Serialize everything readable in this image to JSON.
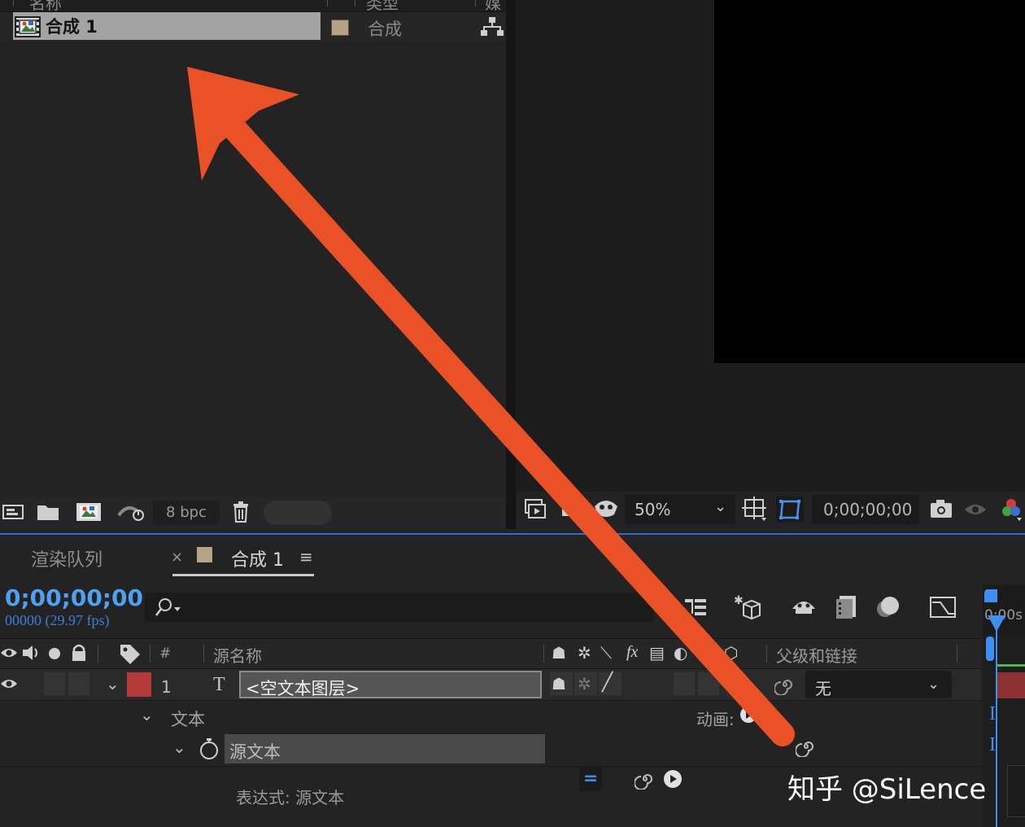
{
  "project": {
    "header_name": "名称",
    "header_type": "类型",
    "header_media": "媒",
    "item": {
      "name": "合成 1",
      "type": "合成",
      "type_color": "#b6a385"
    },
    "footer": {
      "bpc": "8 bpc"
    }
  },
  "viewer": {
    "zoom": "50%",
    "timecode": "0;00;00;00"
  },
  "timeline": {
    "tabs": {
      "render_queue": "渲染队列",
      "comp": "合成 1",
      "close": "×",
      "menu": "≡"
    },
    "timecode": "0;00;00;00",
    "fps": "00000 (29.97 fps)",
    "search": {
      "value": "",
      "placeholder": ""
    },
    "ruler_label": "0:00s",
    "columns": {
      "num": "#",
      "source_name": "源名称",
      "fx": "fx",
      "parent": "父级和链接"
    },
    "layer": {
      "number": "1",
      "type_glyph": "T",
      "name": "<空文本图层>",
      "label_color": "#b43a3a",
      "parent": "无"
    },
    "text_group": "文本",
    "animate_label": "动画:",
    "source_text": "源文本",
    "expression_label": "表达式: 源文本",
    "expr_eq": "="
  },
  "watermark": "知乎 @SiLence",
  "colors": {
    "accent": "#2e6ed1",
    "timecode": "#4fa1f0",
    "arrow": "#ea5126"
  }
}
